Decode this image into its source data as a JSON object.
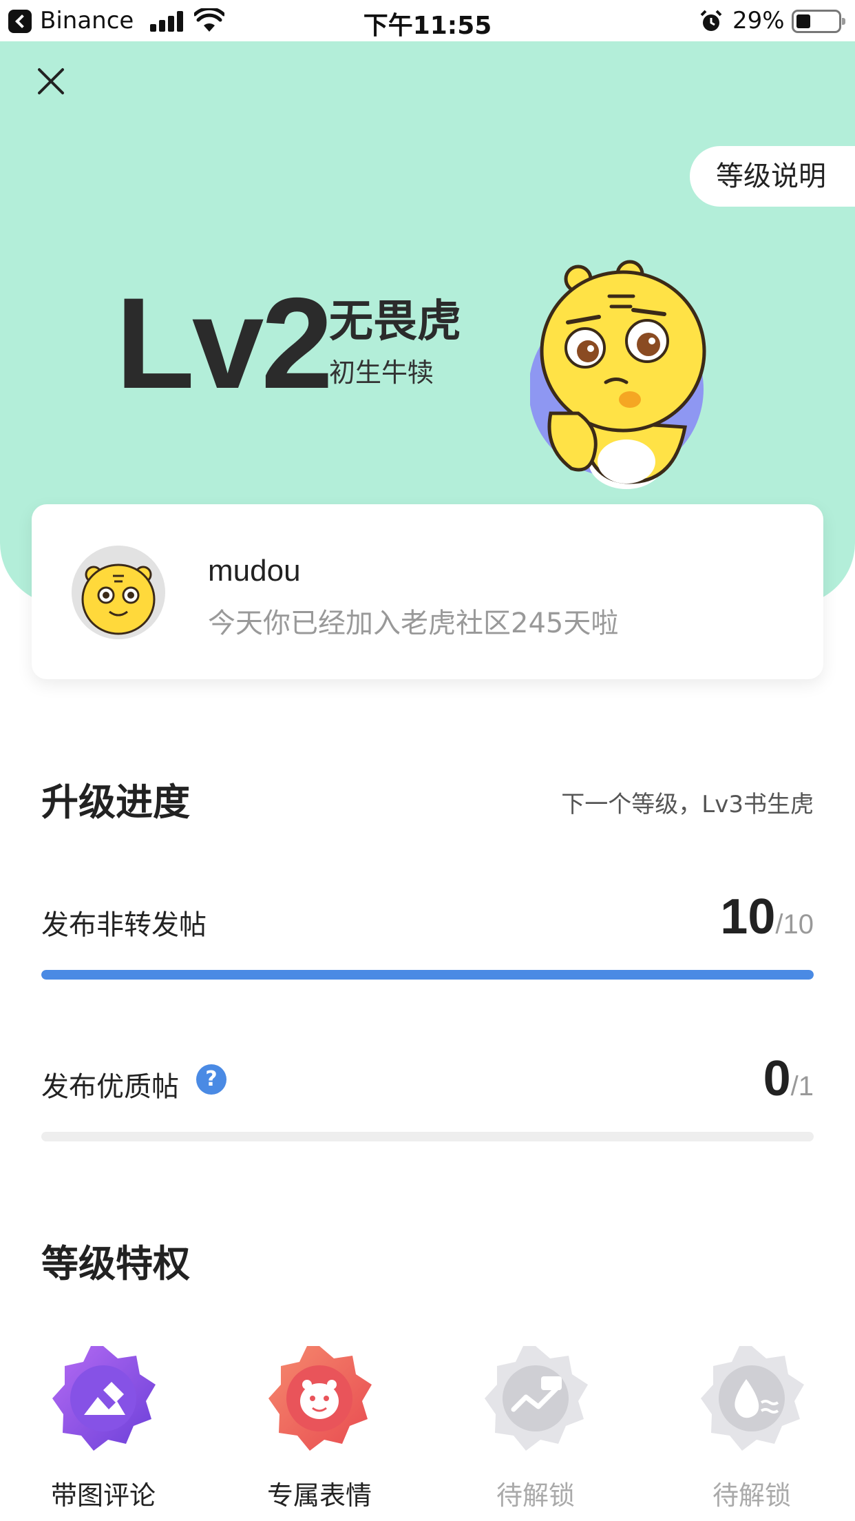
{
  "status_bar": {
    "back_app": "Binance",
    "time": "下午11:55",
    "battery": "29%"
  },
  "hero": {
    "level_explain": "等级说明",
    "level": "Lv2",
    "level_name": "无畏虎",
    "level_subtitle": "初生牛犊",
    "bg_color": "#b3eed9"
  },
  "user": {
    "name": "mudou",
    "join_text": "今天你已经加入老虎社区245天啦"
  },
  "progress": {
    "title": "升级进度",
    "next_level": "下一个等级，Lv3书生虎",
    "tasks": [
      {
        "label": "发布非转发帖",
        "current": "10",
        "total": "/10",
        "fraction": 1.0
      },
      {
        "label": "发布优质帖",
        "current": "0",
        "total": "/1",
        "fraction": 0.0,
        "help": "?"
      }
    ],
    "accent": "#4a8ae4"
  },
  "privileges": {
    "title": "等级特权",
    "items": [
      {
        "label": "带图评论",
        "icon": "image-pencil-icon",
        "unlocked": true
      },
      {
        "label": "专属表情",
        "icon": "tiger-emoji-icon",
        "unlocked": true
      },
      {
        "label": "待解锁",
        "icon": "chart-icon",
        "unlocked": false
      },
      {
        "label": "待解锁",
        "icon": "water-drop-icon",
        "unlocked": false
      }
    ]
  }
}
